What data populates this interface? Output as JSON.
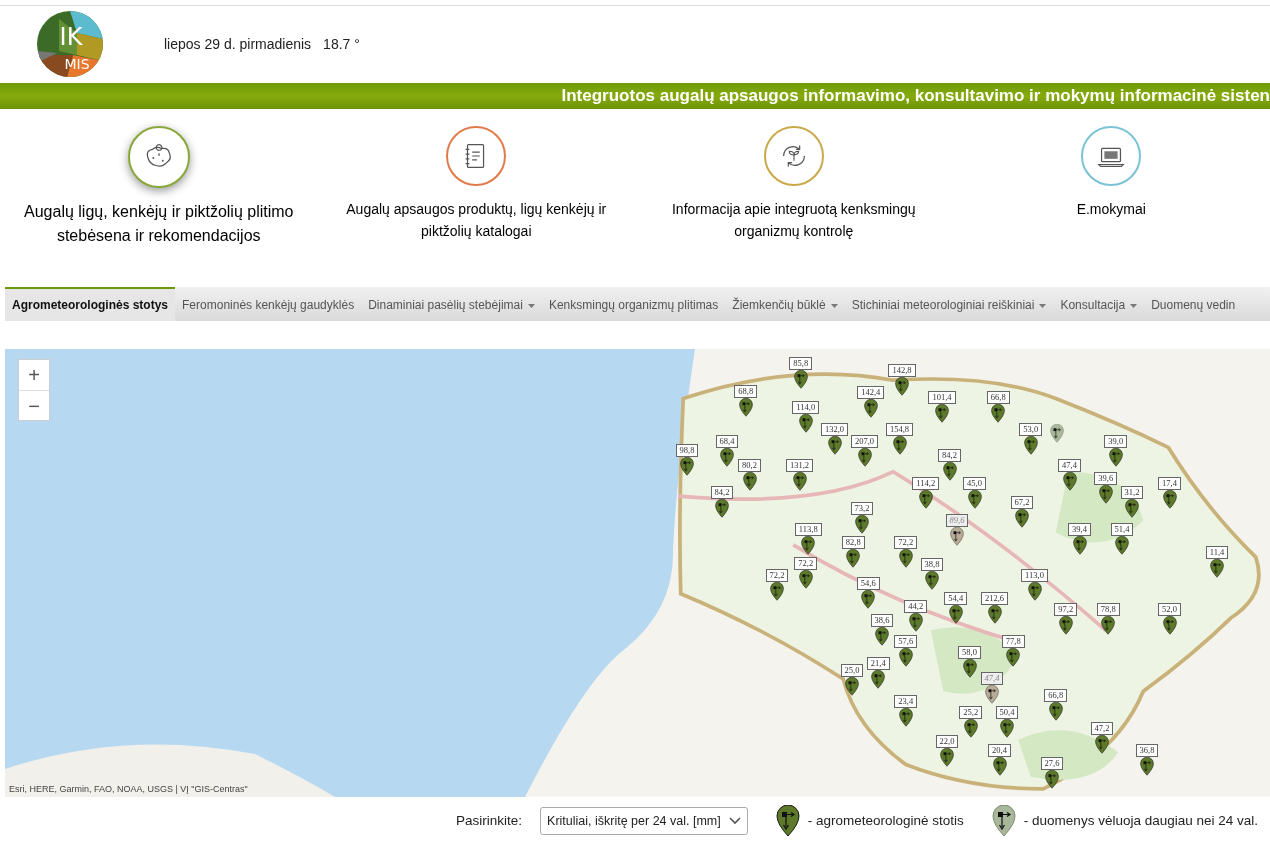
{
  "logo": {
    "line1": "IK",
    "line2": "MIS"
  },
  "header": {
    "date": "liepos 29 d. pirmadienis",
    "temperature": "18.7 °"
  },
  "banner": "Integruotos augalų apsaugos informavimo, konsultavimo ir mokymų informacinė sisten",
  "tiles": [
    {
      "label": "Augalų ligų, kenkėjų ir piktžolių plitimo stebėsena ir rekomendacijos",
      "selected": true
    },
    {
      "label": "Augalų apsaugos produktų, ligų kenkėjų ir piktžolių katalogai",
      "selected": false
    },
    {
      "label": "Informacija apie integruotą kenksmingų organizmų kontrolę",
      "selected": false
    },
    {
      "label": "E.mokymai",
      "selected": false
    }
  ],
  "nav": [
    {
      "label": "Agrometeorologinės stotys",
      "selected": true,
      "dropdown": false
    },
    {
      "label": "Feromoninės kenkėjų gaudyklės",
      "selected": false,
      "dropdown": false
    },
    {
      "label": "Dinaminiai pasėlių stebėjimai",
      "selected": false,
      "dropdown": true
    },
    {
      "label": "Kenksmingų organizmų plitimas",
      "selected": false,
      "dropdown": false
    },
    {
      "label": "Žiemkenčių būklė",
      "selected": false,
      "dropdown": true
    },
    {
      "label": "Stichiniai meteorologiniai reiškiniai",
      "selected": false,
      "dropdown": true
    },
    {
      "label": "Konsultacija",
      "selected": false,
      "dropdown": true
    },
    {
      "label": "Duomenų vedin",
      "selected": false,
      "dropdown": false
    }
  ],
  "map": {
    "zoom_in": "+",
    "zoom_out": "−",
    "attribution": "Esri, HERE, Garmin, FAO, NOAA, USGS | VĮ \"GIS-Centras\"",
    "markers": [
      {
        "label": "85,8",
        "kind": "normal"
      },
      {
        "label": "142,8",
        "kind": "normal"
      },
      {
        "label": "68,8",
        "kind": "normal"
      },
      {
        "label": "142,4",
        "kind": "normal"
      },
      {
        "label": "101,4",
        "kind": "normal"
      },
      {
        "label": "66,8",
        "kind": "normal"
      },
      {
        "label": "114,0",
        "kind": "normal"
      },
      {
        "kind": "delayed"
      },
      {
        "label": "132,0",
        "kind": "normal"
      },
      {
        "label": "154,8",
        "kind": "normal"
      },
      {
        "label": "53,0",
        "kind": "normal"
      },
      {
        "label": "98,8",
        "kind": "normal"
      },
      {
        "label": "68,4",
        "kind": "normal"
      },
      {
        "label": "207,0",
        "kind": "normal"
      },
      {
        "label": "39,0",
        "kind": "normal"
      },
      {
        "label": "84,2",
        "kind": "normal"
      },
      {
        "label": "80,2",
        "kind": "normal"
      },
      {
        "label": "131,2",
        "kind": "normal"
      },
      {
        "label": "47,4",
        "kind": "normal"
      },
      {
        "label": "39,6",
        "kind": "normal"
      },
      {
        "label": "114,2",
        "kind": "normal"
      },
      {
        "label": "45,0",
        "kind": "normal"
      },
      {
        "label": "17,4",
        "kind": "normal"
      },
      {
        "label": "84,2",
        "kind": "normal"
      },
      {
        "label": "31,2",
        "kind": "normal"
      },
      {
        "label": "67,2",
        "kind": "normal"
      },
      {
        "label": "73,2",
        "kind": "normal"
      },
      {
        "label": "89,6",
        "kind": "highlighted"
      },
      {
        "label": "113,8",
        "kind": "normal"
      },
      {
        "label": "39,4",
        "kind": "normal"
      },
      {
        "label": "51,4",
        "kind": "normal"
      },
      {
        "label": "82,8",
        "kind": "normal"
      },
      {
        "label": "72,2",
        "kind": "normal"
      },
      {
        "label": "11,4",
        "kind": "normal"
      },
      {
        "label": "72,2",
        "kind": "normal"
      },
      {
        "label": "38,8",
        "kind": "normal"
      },
      {
        "label": "72,2",
        "kind": "normal"
      },
      {
        "label": "113,0",
        "kind": "normal"
      },
      {
        "label": "54,6",
        "kind": "normal"
      },
      {
        "label": "54,4",
        "kind": "normal"
      },
      {
        "label": "212,6",
        "kind": "normal"
      },
      {
        "label": "44,2",
        "kind": "normal"
      },
      {
        "label": "97,2",
        "kind": "normal"
      },
      {
        "label": "78,8",
        "kind": "normal"
      },
      {
        "label": "52,0",
        "kind": "normal"
      },
      {
        "label": "38,6",
        "kind": "normal"
      },
      {
        "label": "57,6",
        "kind": "normal"
      },
      {
        "label": "77,8",
        "kind": "normal"
      },
      {
        "label": "58,0",
        "kind": "normal"
      },
      {
        "label": "21,4",
        "kind": "normal"
      },
      {
        "label": "25,0",
        "kind": "normal"
      },
      {
        "label": "47,4",
        "kind": "highlighted"
      },
      {
        "label": "66,8",
        "kind": "normal"
      },
      {
        "label": "23,4",
        "kind": "normal"
      },
      {
        "label": "25,2",
        "kind": "normal"
      },
      {
        "label": "50,4",
        "kind": "normal"
      },
      {
        "label": "47,2",
        "kind": "normal"
      },
      {
        "label": "22,0",
        "kind": "normal"
      },
      {
        "label": "20,4",
        "kind": "normal"
      },
      {
        "label": "36,8",
        "kind": "normal"
      },
      {
        "label": "27,6",
        "kind": "normal"
      }
    ]
  },
  "legend": {
    "prompt": "Pasirinkite:",
    "select_value": "Krituliai, iškritę per 24 val. [mm]",
    "items": [
      {
        "kind": "normal",
        "text": "- agrometeorologinė stotis"
      },
      {
        "kind": "delayed",
        "text": "- duomenys vėluoja daugiau nei 24 val."
      }
    ]
  }
}
